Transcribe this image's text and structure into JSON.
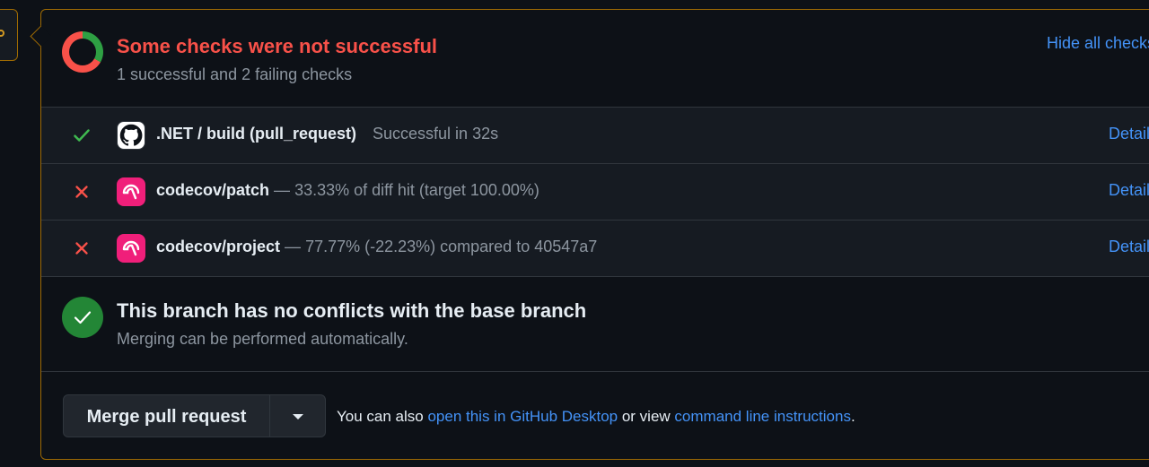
{
  "checks": {
    "title": "Some checks were not successful",
    "subtitle": "1 successful and 2 failing checks",
    "hide_link": "Hide all checks",
    "donut_segments": {
      "successful": 1,
      "failing": 2
    },
    "colors": {
      "success": "#2ea043",
      "failure": "#f85149",
      "link": "#4493f8"
    },
    "items": [
      {
        "status": "success",
        "status_icon": "check-icon",
        "avatar": "github-icon",
        "name": ".NET / build (pull_request)",
        "separator": "",
        "description": "Successful in 32s",
        "details": "Details"
      },
      {
        "status": "failure",
        "status_icon": "x-icon",
        "avatar": "codecov-icon",
        "name": "codecov/patch",
        "separator": " — ",
        "description": "33.33% of diff hit (target 100.00%)",
        "details": "Details"
      },
      {
        "status": "failure",
        "status_icon": "x-icon",
        "avatar": "codecov-icon",
        "name": "codecov/project",
        "separator": " — ",
        "description": "77.77% (-22.23%) compared to 40547a7",
        "details": "Details"
      }
    ]
  },
  "conflicts": {
    "title": "This branch has no conflicts with the base branch",
    "subtitle": "Merging can be performed automatically."
  },
  "merge": {
    "button_label": "Merge pull request",
    "help_prefix": "You can also ",
    "desktop_link": "open this in GitHub Desktop",
    "help_middle": " or view ",
    "cli_link": "command line instructions",
    "help_suffix": "."
  }
}
